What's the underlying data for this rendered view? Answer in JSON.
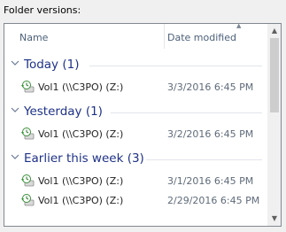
{
  "caption": "Folder versions:",
  "columns": {
    "name": "Name",
    "date_modified": "Date modified"
  },
  "groups": [
    {
      "title": "Today (1)",
      "items": [
        {
          "name": "Vol1 (\\\\C3PO) (Z:)",
          "date": "3/3/2016 6:45 PM"
        }
      ]
    },
    {
      "title": "Yesterday (1)",
      "items": [
        {
          "name": "Vol1 (\\\\C3PO) (Z:)",
          "date": "3/2/2016 6:45 PM"
        }
      ]
    },
    {
      "title": "Earlier this week (3)",
      "items": [
        {
          "name": "Vol1 (\\\\C3PO) (Z:)",
          "date": "3/1/2016 6:45 PM"
        },
        {
          "name": "Vol1 (\\\\C3PO) (Z:)",
          "date": "2/29/2016 6:45 PM"
        }
      ]
    }
  ],
  "icons": {
    "group_toggle": "chevron-down-icon",
    "item": "restore-drive-icon",
    "sort": "sort-caret-up-icon"
  },
  "colors": {
    "group_title": "#1e3287",
    "header_text": "#4c607a"
  }
}
